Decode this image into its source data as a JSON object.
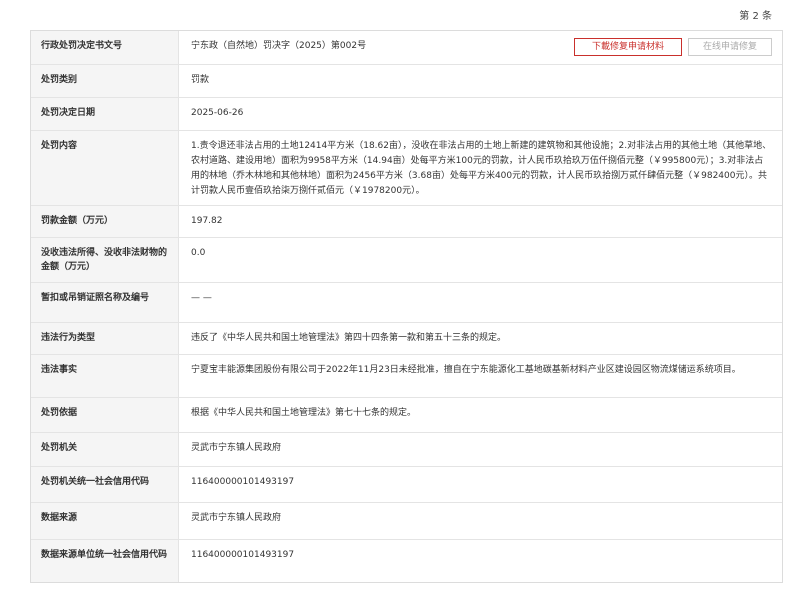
{
  "page_indicator": "第 2 条",
  "buttons": {
    "download": "下載修复申请材料",
    "online_repair": "在线申请修复"
  },
  "colors": {
    "label_bg": "#f5f5f5",
    "download_button": "#c9302c",
    "disabled_button": "#aaaaaa"
  },
  "rows": [
    {
      "label": "行政处罚决定书文号",
      "value": "宁东政（自然地）罚决字（2025）第002号"
    },
    {
      "label": "处罚类别",
      "value": "罚款"
    },
    {
      "label": "处罚决定日期",
      "value": "2025-06-26"
    },
    {
      "label": "处罚内容",
      "value": "1.责令退还非法占用的土地12414平方米（18.62亩），没收在非法占用的土地上新建的建筑物和其他设施；2.对非法占用的其他土地（其他草地、农村道路、建设用地）面积为9958平方米（14.94亩）处每平方米100元的罚款，计人民币玖拾玖万伍仟捌佰元整（￥995800元）；3.对非法占用的林地（乔木林地和其他林地）面积为2456平方米（3.68亩）处每平方米400元的罚款，计人民币玖拾捌万贰仟肆佰元整（￥982400元）。共计罚款人民币壹佰玖拾柒万捌仟贰佰元（￥1978200元）。"
    },
    {
      "label": "罚款金额（万元）",
      "value": "197.82"
    },
    {
      "label": "没收违法所得、没收非法财物的金额（万元）",
      "value": "0.0"
    },
    {
      "label": "暂扣或吊销证照名称及编号",
      "value": "— —"
    },
    {
      "label": "违法行为类型",
      "value": "违反了《中华人民共和国土地管理法》第四十四条第一款和第五十三条的规定。"
    },
    {
      "label": "违法事实",
      "value": "宁夏宝丰能源集团股份有限公司于2022年11月23日未经批准，擅自在宁东能源化工基地碳基新材料产业区建设园区物流煤储运系统项目。"
    },
    {
      "label": "处罚依据",
      "value": "根据《中华人民共和国土地管理法》第七十七条的规定。"
    },
    {
      "label": "处罚机关",
      "value": "灵武市宁东镇人民政府"
    },
    {
      "label": "处罚机关统一社会信用代码",
      "value": "11640000010149319​7"
    },
    {
      "label": "数据来源",
      "value": "灵武市宁东镇人民政府"
    },
    {
      "label": "数据来源单位统一社会信用代码",
      "value": "116400000101493197"
    }
  ]
}
